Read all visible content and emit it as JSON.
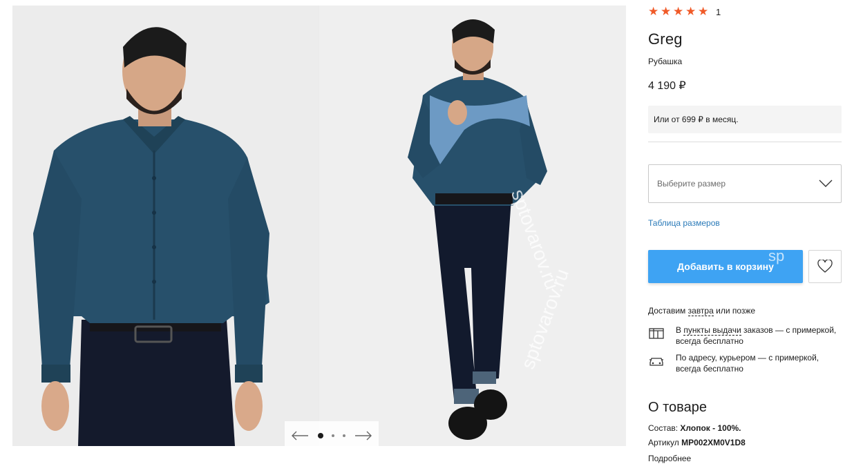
{
  "rating": {
    "stars": 5,
    "count": "1"
  },
  "product": {
    "brand": "Greg",
    "category": "Рубашка",
    "price": "4 190 ₽",
    "installment": "Или от 699 ₽ в месяц."
  },
  "size_select": {
    "placeholder": "Выберите размер"
  },
  "size_table_link": "Таблица размеров",
  "add_to_cart": "Добавить в корзину",
  "delivery": {
    "intro_pre": "Доставим ",
    "intro_link": "завтра",
    "intro_post": " или позже",
    "options": [
      {
        "pre": "В ",
        "link": "пункты выдачи",
        "post": " заказов — с примеркой, всегда бесплатно"
      },
      {
        "pre": "",
        "link": "",
        "post": "По адресу, курьером — с примеркой, всегда бесплатно"
      }
    ]
  },
  "about": {
    "title": "О товаре",
    "composition_label": "Состав: ",
    "composition_value": "Хлопок - 100%.",
    "sku_label": "Артикул ",
    "sku_value": "MP002XM0V1D8",
    "more": "Подробнее"
  },
  "gallery": {
    "total_slides": 3,
    "active_slide": 1
  },
  "watermarks": [
    "sptovarov.ru",
    "sptovarov.ru",
    "sptovarov.ru",
    "sp"
  ],
  "colors": {
    "accent": "#3ea3f3",
    "star": "#f05a28",
    "link": "#2a7ab8"
  }
}
